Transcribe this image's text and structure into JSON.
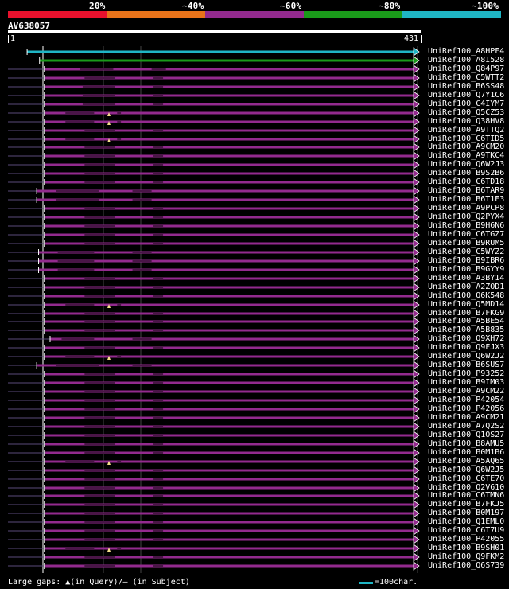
{
  "colors": {
    "bg": "#000000",
    "bin20": "#e8112d",
    "bin40": "#e8731a",
    "bin60": "#932a8e",
    "bin80": "#1a9a1a",
    "bin100": "#1fb5c4",
    "gap_marker": "#f5e08a",
    "text": "#ffffff"
  },
  "legend": {
    "labels": [
      "20%",
      "~40%",
      "~60%",
      "~80%",
      "~100%"
    ]
  },
  "query": {
    "id": "AV638057",
    "start": "1",
    "end": "431"
  },
  "footer": {
    "gaps_text": "Large gaps: ▲(in Query)/– (in Subject)",
    "scale_text": "=100char."
  },
  "hits": [
    {
      "id": "UniRef100_A8HPF4",
      "bin": "bin100",
      "start": 20,
      "gaps": [],
      "marker": false,
      "subj_prefix": false
    },
    {
      "id": "UniRef100_A8I528",
      "bin": "bin80",
      "start": 33,
      "gaps": [],
      "marker": false,
      "subj_prefix": false
    },
    {
      "id": "UniRef100_Q84P97",
      "bin": "bin60",
      "start": 38,
      "gaps": [
        [
          75,
          110
        ],
        [
          150,
          165
        ]
      ],
      "marker": false,
      "subj_prefix": true
    },
    {
      "id": "UniRef100_C5WTT2",
      "bin": "bin60",
      "start": 38,
      "gaps": [
        [
          80,
          112
        ],
        [
          152,
          162
        ]
      ],
      "marker": false,
      "subj_prefix": true
    },
    {
      "id": "UniRef100_B6SS48",
      "bin": "bin60",
      "start": 38,
      "gaps": [
        [
          78,
          112
        ],
        [
          152,
          162
        ]
      ],
      "marker": false,
      "subj_prefix": true
    },
    {
      "id": "UniRef100_Q7Y1C6",
      "bin": "bin60",
      "start": 38,
      "gaps": [
        [
          78,
          112
        ],
        [
          152,
          162
        ]
      ],
      "marker": false,
      "subj_prefix": true
    },
    {
      "id": "UniRef100_C4IYM7",
      "bin": "bin60",
      "start": 38,
      "gaps": [
        [
          78,
          112
        ],
        [
          152,
          162
        ]
      ],
      "marker": false,
      "subj_prefix": true
    },
    {
      "id": "UniRef100_Q5CZ53",
      "bin": "bin60",
      "start": 38,
      "gaps": [
        [
          60,
          90
        ],
        [
          114,
          118
        ]
      ],
      "marker": true,
      "subj_prefix": true
    },
    {
      "id": "UniRef100_Q38HV8",
      "bin": "bin60",
      "start": 38,
      "gaps": [
        [
          60,
          90
        ],
        [
          114,
          118
        ]
      ],
      "marker": true,
      "subj_prefix": true
    },
    {
      "id": "UniRef100_A9TTQ2",
      "bin": "bin60",
      "start": 38,
      "gaps": [
        [
          80,
          112
        ],
        [
          152,
          162
        ]
      ],
      "marker": false,
      "subj_prefix": true
    },
    {
      "id": "UniRef100_C6TID5",
      "bin": "bin60",
      "start": 38,
      "gaps": [
        [
          60,
          90
        ],
        [
          114,
          118
        ]
      ],
      "marker": true,
      "subj_prefix": true
    },
    {
      "id": "UniRef100_A9CM20",
      "bin": "bin60",
      "start": 38,
      "gaps": [
        [
          80,
          112
        ],
        [
          152,
          162
        ]
      ],
      "marker": false,
      "subj_prefix": true
    },
    {
      "id": "UniRef100_A9TKC4",
      "bin": "bin60",
      "start": 38,
      "gaps": [
        [
          80,
          112
        ],
        [
          152,
          162
        ]
      ],
      "marker": false,
      "subj_prefix": true
    },
    {
      "id": "UniRef100_Q6W2J3",
      "bin": "bin60",
      "start": 38,
      "gaps": [
        [
          80,
          112
        ],
        [
          152,
          162
        ]
      ],
      "marker": false,
      "subj_prefix": true
    },
    {
      "id": "UniRef100_B9S2B6",
      "bin": "bin60",
      "start": 38,
      "gaps": [
        [
          80,
          112
        ],
        [
          152,
          162
        ]
      ],
      "marker": false,
      "subj_prefix": true
    },
    {
      "id": "UniRef100_C6TD18",
      "bin": "bin60",
      "start": 38,
      "gaps": [
        [
          80,
          112
        ],
        [
          152,
          162
        ]
      ],
      "marker": false,
      "subj_prefix": true
    },
    {
      "id": "UniRef100_B6TAR9",
      "bin": "bin60",
      "start": 30,
      "gaps": [
        [
          50,
          95
        ],
        [
          130,
          150
        ]
      ],
      "marker": false,
      "subj_prefix": true
    },
    {
      "id": "UniRef100_B6T1E3",
      "bin": "bin60",
      "start": 30,
      "gaps": [
        [
          50,
          95
        ],
        [
          130,
          150
        ]
      ],
      "marker": false,
      "subj_prefix": true
    },
    {
      "id": "UniRef100_A9PCP8",
      "bin": "bin60",
      "start": 38,
      "gaps": [
        [
          80,
          112
        ],
        [
          152,
          162
        ]
      ],
      "marker": false,
      "subj_prefix": true
    },
    {
      "id": "UniRef100_Q2PYX4",
      "bin": "bin60",
      "start": 38,
      "gaps": [
        [
          80,
          112
        ],
        [
          152,
          162
        ]
      ],
      "marker": false,
      "subj_prefix": true
    },
    {
      "id": "UniRef100_B9H6N6",
      "bin": "bin60",
      "start": 38,
      "gaps": [
        [
          80,
          112
        ],
        [
          152,
          162
        ]
      ],
      "marker": false,
      "subj_prefix": true
    },
    {
      "id": "UniRef100_C6TGZ7",
      "bin": "bin60",
      "start": 38,
      "gaps": [
        [
          80,
          112
        ],
        [
          152,
          162
        ]
      ],
      "marker": false,
      "subj_prefix": true
    },
    {
      "id": "UniRef100_B9RUM5",
      "bin": "bin60",
      "start": 38,
      "gaps": [
        [
          80,
          112
        ],
        [
          152,
          162
        ]
      ],
      "marker": false,
      "subj_prefix": true
    },
    {
      "id": "UniRef100_C5WYZ2",
      "bin": "bin60",
      "start": 32,
      "gaps": [
        [
          52,
          90
        ],
        [
          130,
          150
        ]
      ],
      "marker": false,
      "subj_prefix": true
    },
    {
      "id": "UniRef100_B9IBR6",
      "bin": "bin60",
      "start": 32,
      "gaps": [
        [
          52,
          90
        ],
        [
          130,
          150
        ]
      ],
      "marker": false,
      "subj_prefix": true
    },
    {
      "id": "UniRef100_B9GYY9",
      "bin": "bin60",
      "start": 32,
      "gaps": [
        [
          52,
          90
        ],
        [
          130,
          150
        ]
      ],
      "marker": false,
      "subj_prefix": true
    },
    {
      "id": "UniRef100_A3BY14",
      "bin": "bin60",
      "start": 38,
      "gaps": [
        [
          80,
          112
        ],
        [
          152,
          162
        ]
      ],
      "marker": false,
      "subj_prefix": true
    },
    {
      "id": "UniRef100_A2ZOD1",
      "bin": "bin60",
      "start": 38,
      "gaps": [
        [
          80,
          112
        ],
        [
          152,
          162
        ]
      ],
      "marker": false,
      "subj_prefix": true
    },
    {
      "id": "UniRef100_Q6K548",
      "bin": "bin60",
      "start": 38,
      "gaps": [
        [
          80,
          112
        ],
        [
          152,
          162
        ]
      ],
      "marker": false,
      "subj_prefix": true
    },
    {
      "id": "UniRef100_Q5MD14",
      "bin": "bin60",
      "start": 38,
      "gaps": [
        [
          60,
          90
        ],
        [
          114,
          118
        ]
      ],
      "marker": true,
      "subj_prefix": true
    },
    {
      "id": "UniRef100_B7FKG9",
      "bin": "bin60",
      "start": 38,
      "gaps": [
        [
          80,
          112
        ],
        [
          152,
          162
        ]
      ],
      "marker": false,
      "subj_prefix": true
    },
    {
      "id": "UniRef100_A5BE54",
      "bin": "bin60",
      "start": 38,
      "gaps": [
        [
          80,
          112
        ],
        [
          152,
          162
        ]
      ],
      "marker": false,
      "subj_prefix": true
    },
    {
      "id": "UniRef100_A5B835",
      "bin": "bin60",
      "start": 38,
      "gaps": [
        [
          80,
          112
        ],
        [
          152,
          162
        ]
      ],
      "marker": false,
      "subj_prefix": true
    },
    {
      "id": "UniRef100_Q9XH72",
      "bin": "bin60",
      "start": 44,
      "gaps": [
        [
          56,
          90
        ],
        [
          130,
          150
        ]
      ],
      "marker": false,
      "subj_prefix": true
    },
    {
      "id": "UniRef100_Q9FJX3",
      "bin": "bin60",
      "start": 38,
      "gaps": [
        [
          80,
          112
        ],
        [
          152,
          162
        ]
      ],
      "marker": false,
      "subj_prefix": true
    },
    {
      "id": "UniRef100_Q6W2J2",
      "bin": "bin60",
      "start": 38,
      "gaps": [
        [
          60,
          90
        ],
        [
          114,
          118
        ]
      ],
      "marker": true,
      "subj_prefix": true
    },
    {
      "id": "UniRef100_B6SUS7",
      "bin": "bin60",
      "start": 30,
      "gaps": [
        [
          50,
          95
        ],
        [
          130,
          150
        ]
      ],
      "marker": false,
      "subj_prefix": true
    },
    {
      "id": "UniRef100_P93252",
      "bin": "bin60",
      "start": 38,
      "gaps": [
        [
          80,
          112
        ],
        [
          152,
          162
        ]
      ],
      "marker": false,
      "subj_prefix": true
    },
    {
      "id": "UniRef100_B9IM03",
      "bin": "bin60",
      "start": 38,
      "gaps": [
        [
          80,
          112
        ],
        [
          152,
          162
        ]
      ],
      "marker": false,
      "subj_prefix": true
    },
    {
      "id": "UniRef100_A9CM22",
      "bin": "bin60",
      "start": 38,
      "gaps": [
        [
          80,
          112
        ],
        [
          152,
          162
        ]
      ],
      "marker": false,
      "subj_prefix": true
    },
    {
      "id": "UniRef100_P42054",
      "bin": "bin60",
      "start": 38,
      "gaps": [
        [
          80,
          112
        ],
        [
          152,
          162
        ]
      ],
      "marker": false,
      "subj_prefix": true
    },
    {
      "id": "UniRef100_P42056",
      "bin": "bin60",
      "start": 38,
      "gaps": [
        [
          80,
          112
        ],
        [
          152,
          162
        ]
      ],
      "marker": false,
      "subj_prefix": true
    },
    {
      "id": "UniRef100_A9CM21",
      "bin": "bin60",
      "start": 38,
      "gaps": [
        [
          80,
          112
        ],
        [
          152,
          162
        ]
      ],
      "marker": false,
      "subj_prefix": true
    },
    {
      "id": "UniRef100_A7Q2S2",
      "bin": "bin60",
      "start": 38,
      "gaps": [
        [
          80,
          112
        ],
        [
          152,
          162
        ]
      ],
      "marker": false,
      "subj_prefix": true
    },
    {
      "id": "UniRef100_Q1OS27",
      "bin": "bin60",
      "start": 38,
      "gaps": [
        [
          80,
          112
        ],
        [
          152,
          162
        ]
      ],
      "marker": false,
      "subj_prefix": true
    },
    {
      "id": "UniRef100_B8AMU5",
      "bin": "bin60",
      "start": 38,
      "gaps": [
        [
          80,
          112
        ],
        [
          152,
          162
        ]
      ],
      "marker": false,
      "subj_prefix": true
    },
    {
      "id": "UniRef100_B0M1B6",
      "bin": "bin60",
      "start": 38,
      "gaps": [
        [
          80,
          112
        ],
        [
          152,
          162
        ]
      ],
      "marker": false,
      "subj_prefix": true
    },
    {
      "id": "UniRef100_A5AQ65",
      "bin": "bin60",
      "start": 38,
      "gaps": [
        [
          60,
          90
        ],
        [
          114,
          118
        ]
      ],
      "marker": true,
      "subj_prefix": true
    },
    {
      "id": "UniRef100_Q6W2J5",
      "bin": "bin60",
      "start": 38,
      "gaps": [
        [
          80,
          112
        ],
        [
          152,
          162
        ]
      ],
      "marker": false,
      "subj_prefix": true
    },
    {
      "id": "UniRef100_C6TE70",
      "bin": "bin60",
      "start": 38,
      "gaps": [
        [
          80,
          112
        ],
        [
          152,
          162
        ]
      ],
      "marker": false,
      "subj_prefix": true
    },
    {
      "id": "UniRef100_Q2V610",
      "bin": "bin60",
      "start": 38,
      "gaps": [
        [
          80,
          112
        ],
        [
          152,
          162
        ]
      ],
      "marker": false,
      "subj_prefix": true
    },
    {
      "id": "UniRef100_C6TMN6",
      "bin": "bin60",
      "start": 38,
      "gaps": [
        [
          80,
          112
        ],
        [
          152,
          162
        ]
      ],
      "marker": false,
      "subj_prefix": true
    },
    {
      "id": "UniRef100_B7FKJ5",
      "bin": "bin60",
      "start": 38,
      "gaps": [
        [
          80,
          112
        ],
        [
          152,
          162
        ]
      ],
      "marker": false,
      "subj_prefix": true
    },
    {
      "id": "UniRef100_B0M197",
      "bin": "bin60",
      "start": 38,
      "gaps": [
        [
          80,
          112
        ],
        [
          152,
          162
        ]
      ],
      "marker": false,
      "subj_prefix": true
    },
    {
      "id": "UniRef100_Q1EML0",
      "bin": "bin60",
      "start": 38,
      "gaps": [
        [
          80,
          112
        ],
        [
          152,
          162
        ]
      ],
      "marker": false,
      "subj_prefix": true
    },
    {
      "id": "UniRef100_C6T7U9",
      "bin": "bin60",
      "start": 38,
      "gaps": [
        [
          80,
          112
        ],
        [
          152,
          162
        ]
      ],
      "marker": false,
      "subj_prefix": true
    },
    {
      "id": "UniRef100_P42055",
      "bin": "bin60",
      "start": 38,
      "gaps": [
        [
          80,
          112
        ],
        [
          152,
          162
        ]
      ],
      "marker": false,
      "subj_prefix": true
    },
    {
      "id": "UniRef100_B9SH01",
      "bin": "bin60",
      "start": 38,
      "gaps": [
        [
          60,
          90
        ],
        [
          114,
          118
        ]
      ],
      "marker": true,
      "subj_prefix": true
    },
    {
      "id": "UniRef100_Q9FKM2",
      "bin": "bin60",
      "start": 38,
      "gaps": [
        [
          80,
          112
        ],
        [
          152,
          162
        ]
      ],
      "marker": false,
      "subj_prefix": true
    },
    {
      "id": "UniRef100_Q6S739",
      "bin": "bin60",
      "start": 38,
      "gaps": [
        [
          80,
          112
        ],
        [
          152,
          162
        ]
      ],
      "marker": false,
      "subj_prefix": true
    }
  ]
}
